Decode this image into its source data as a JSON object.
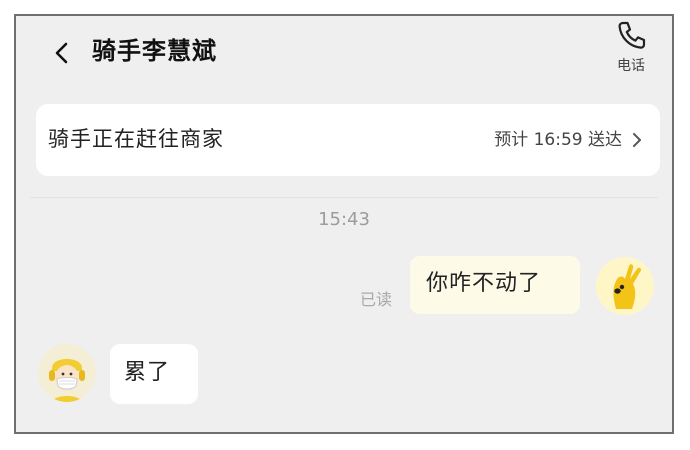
{
  "header": {
    "title": "骑手李慧斌",
    "call_label": "电话"
  },
  "status_card": {
    "status_text": "骑手正在赶往商家",
    "eta_text": "预计 16:59 送达"
  },
  "chat": {
    "timestamp": "15:43",
    "messages": [
      {
        "sender": "me",
        "text": "你咋不动了",
        "read_receipt": "已读"
      },
      {
        "sender": "rider",
        "text": "累了"
      }
    ]
  },
  "colors": {
    "background": "#efefef",
    "card": "#ffffff",
    "outgoing_bubble": "#fdfbe8",
    "timestamp": "#9c9c9c"
  },
  "icons": {
    "back": "chevron-left-icon",
    "call": "phone-icon",
    "eta_arrow": "chevron-right-icon"
  }
}
